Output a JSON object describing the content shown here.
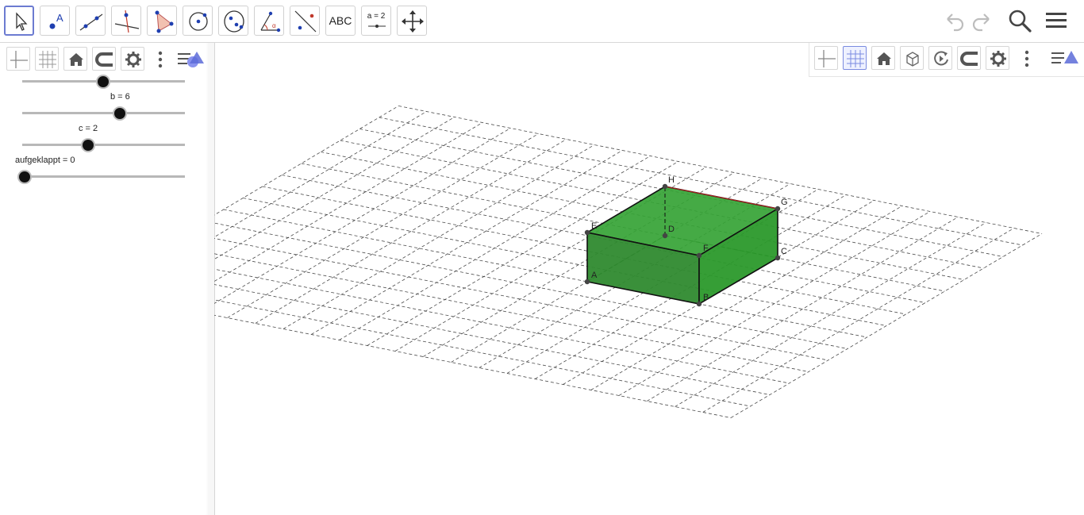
{
  "toolbar": {
    "tools": [
      {
        "name": "move-tool-icon",
        "selected": true
      },
      {
        "name": "point-tool-icon"
      },
      {
        "name": "line-tool-icon"
      },
      {
        "name": "perpendicular-line-tool-icon"
      },
      {
        "name": "polygon-tool-icon"
      },
      {
        "name": "circle-tool-icon"
      },
      {
        "name": "ellipse-tool-icon"
      },
      {
        "name": "angle-tool-icon"
      },
      {
        "name": "reflect-tool-icon"
      },
      {
        "name": "text-tool-icon",
        "label": "ABC"
      },
      {
        "name": "slider-tool-icon",
        "label": "a = 2"
      },
      {
        "name": "move-graphics-tool-icon"
      }
    ],
    "undo_icon": "undo-icon",
    "redo_icon": "redo-icon",
    "search_icon": "search-icon",
    "menu_icon": "hamburger-menu-icon"
  },
  "algebra_view": {
    "sliders": [
      {
        "label": "",
        "value_fraction": 0.49
      },
      {
        "label": "b = 6",
        "value_fraction": 0.59
      },
      {
        "label": "c = 2",
        "value_fraction": 0.4
      },
      {
        "label": "aufgeklappt = 0",
        "value_fraction": 0.0
      }
    ]
  },
  "graphics_3d": {
    "points": {
      "A": "A",
      "B": "B",
      "C": "C",
      "D": "D",
      "E": "E",
      "F": "F",
      "G": "G",
      "H": "H"
    },
    "fill_color": "#2e9a2e",
    "edge_color": "#111111"
  }
}
